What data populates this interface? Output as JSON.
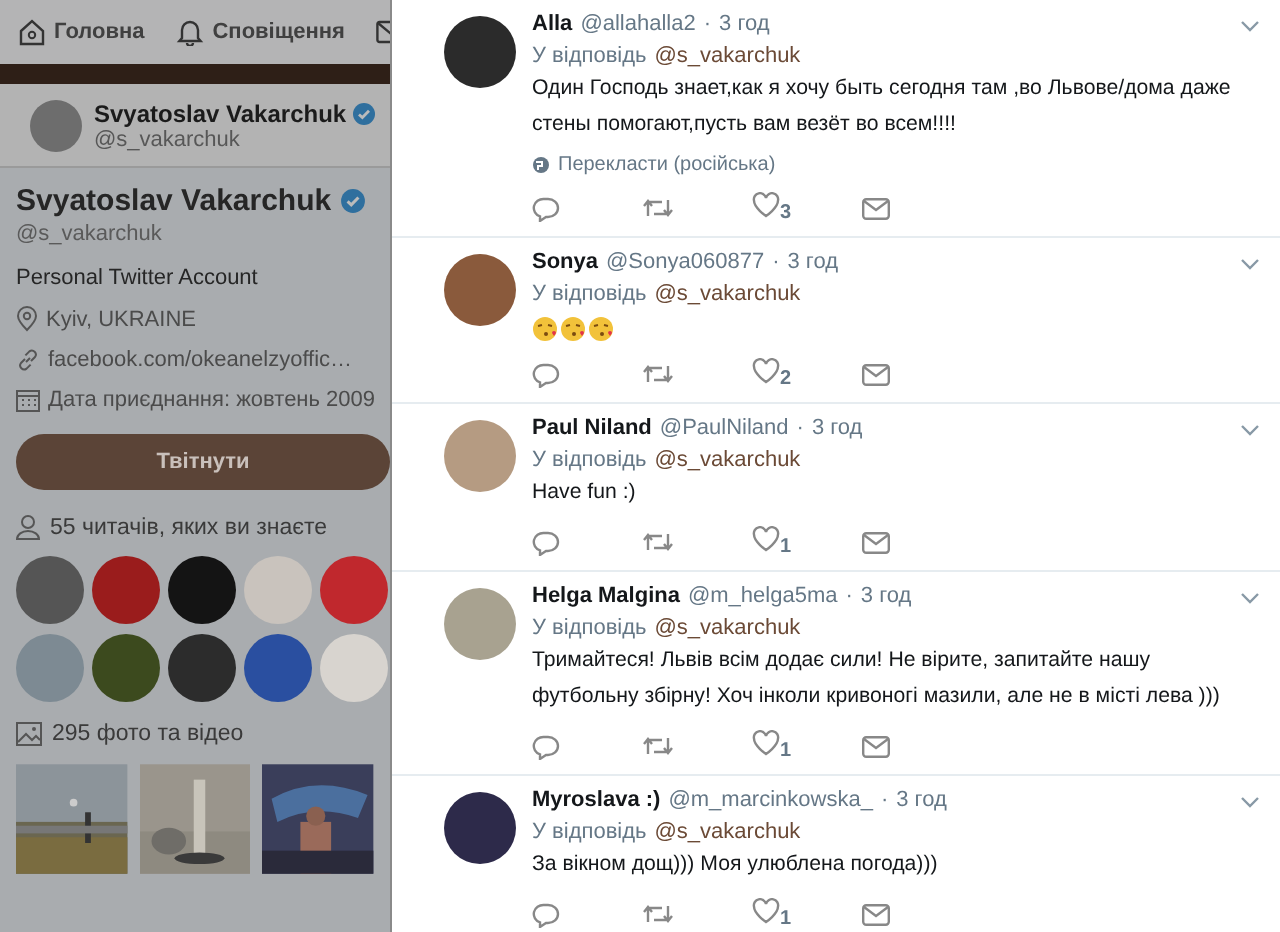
{
  "nav": {
    "items": [
      {
        "label": "Головна",
        "kind": "home"
      },
      {
        "label": "Сповіщення",
        "kind": "bell"
      },
      {
        "kind": "mail"
      }
    ]
  },
  "profile_card": {
    "name": "Svyatoslav Vakarchuk",
    "handle": "@s_vakarchuk",
    "verified": true
  },
  "profile": {
    "name": "Svyatoslav Vakarchuk",
    "handle": "@s_vakarchuk",
    "verified": true,
    "bio": "Personal Twitter Account",
    "location": "Kyiv, UKRAINE",
    "website": "facebook.com/okeanelzyoffic…",
    "joined": "Дата приєднання: жовтень 2009"
  },
  "tweet_button": "Твітнути",
  "followers_known": {
    "label": "55 читачів, яких ви знаєте",
    "avatars": [
      {
        "color": "#555555"
      },
      {
        "color": "#9a1c1c"
      },
      {
        "color": "#141414"
      },
      {
        "color": "#c9c3bd"
      },
      {
        "color": "#c0282d"
      },
      {
        "color": "#7d8a93"
      },
      {
        "color": "#3c4a1e"
      },
      {
        "color": "#2c2c2c"
      },
      {
        "color": "#2a4fa0"
      },
      {
        "color": "#d8d4cf"
      }
    ]
  },
  "media": {
    "label": "295 фото та відео"
  },
  "tweets": [
    {
      "name": "Alla",
      "handle": "@allahalla2",
      "dot": "·",
      "time": "3 год",
      "reply_label": "У відповідь",
      "reply_to": "@s_vakarchuk",
      "body": {
        "kind": "text",
        "text": "Один Господь знает,как я хочу быть сегодня там ,во Львове/дома даже стены помогают,пусть вам везёт во всем!!!!"
      },
      "translate": "Перекласти (російська)",
      "likes": "3",
      "color": "#2b2b2b"
    },
    {
      "name": "Sonya",
      "handle": "@Sonya060877",
      "dot": "·",
      "time": "3 год",
      "reply_label": "У відповідь",
      "reply_to": "@s_vakarchuk",
      "body": {
        "kind": "emoji",
        "emojis": [
          {
            "kind": "kiss"
          },
          {
            "kind": "kiss"
          },
          {
            "kind": "kiss"
          }
        ]
      },
      "likes": "2",
      "color": "#8a5a3c"
    },
    {
      "name": "Paul Niland",
      "handle": "@PaulNiland",
      "dot": "·",
      "time": "3 год",
      "reply_label": "У відповідь",
      "reply_to": "@s_vakarchuk",
      "body": {
        "kind": "text",
        "text": "Have fun :)"
      },
      "likes": "1",
      "color": "#b59b82"
    },
    {
      "name": "Helga Malgina",
      "handle": "@m_helga5ma",
      "dot": "·",
      "time": "3 год",
      "reply_label": "У відповідь",
      "reply_to": "@s_vakarchuk",
      "body": {
        "kind": "text",
        "text": "Тримайтеся! Львів всім додає сили! Не вірите, запитайте нашу футбольну збірну! Хоч інколи кривоногі мазили, але не в місті лева )))"
      },
      "likes": "1",
      "color": "#a8a290"
    },
    {
      "name": "Myroslava :)",
      "handle": "@m_marcinkowska_",
      "dot": "·",
      "time": "3 год",
      "reply_label": "У відповідь",
      "reply_to": "@s_vakarchuk",
      "body": {
        "kind": "text",
        "text": "За вікном дощ))) Моя улюблена погода)))"
      },
      "likes": "1",
      "color": "#2d2a4a"
    }
  ]
}
